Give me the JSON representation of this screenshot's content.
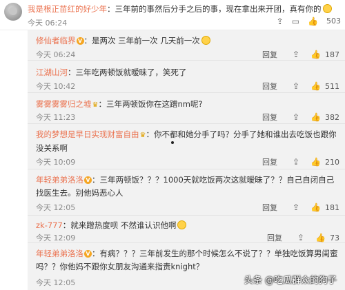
{
  "main_comment": {
    "username": "我是根正苗红的好少年",
    "text": "：三年前的事然后分手之后的事，现在拿出来开团，真有你的",
    "date": "今天 06:24",
    "share_icon": "share-icon",
    "comment_icon": "comment-icon",
    "like_icon": "thumbs-up-icon",
    "likes": "503"
  },
  "replies": [
    {
      "username": "修仙者临界",
      "text": "：是两次  三年前一次  几天前一次",
      "time": "今天 06:24",
      "reply_label": "回复",
      "likes": "187"
    },
    {
      "username": "江湖山河",
      "text": "：三年吃两顿饭就暧昧了，笑死了",
      "time": "今天 10:42",
      "reply_label": "回复",
      "likes": "511"
    },
    {
      "username": "雾雾雾雾归之墟",
      "text": "：三年两顿饭你在这蹭nm呢?",
      "time": "今天 11:23",
      "reply_label": "回复",
      "likes": "382"
    },
    {
      "username": "我的梦想是早日实现财富自由",
      "text": "：你不都和她分手了吗？分手了她和谁出去吃饭也跟你没关系啊",
      "time": "今天 10:09",
      "reply_label": "回复",
      "likes": "210"
    },
    {
      "username": "年轻弟弟洛洛",
      "text": "：三年两顿饭？？？1000天就吃饭两次这就暧昧了？？自己自闭自己找医生去。别他妈恶心人",
      "time": "今天 12:05",
      "reply_label": "回复",
      "likes": "181"
    },
    {
      "username": "zk-777",
      "text": "：就来蹭热度呗   不然谁认识他啊",
      "time": "今天 12:09",
      "reply_label": "回复",
      "likes": "73"
    },
    {
      "username": "年轻弟弟洛洛",
      "text": "：有病？？？三年前发生的那个时候怎么不说了？？单独吃饭算男闺蜜吗？？你他妈不跟你女朋友沟通来指责knight？",
      "time": "今天 12:05",
      "reply_label": "回复",
      "likes": ""
    }
  ],
  "watermark": "头条 @吃瓜群众的狗子"
}
